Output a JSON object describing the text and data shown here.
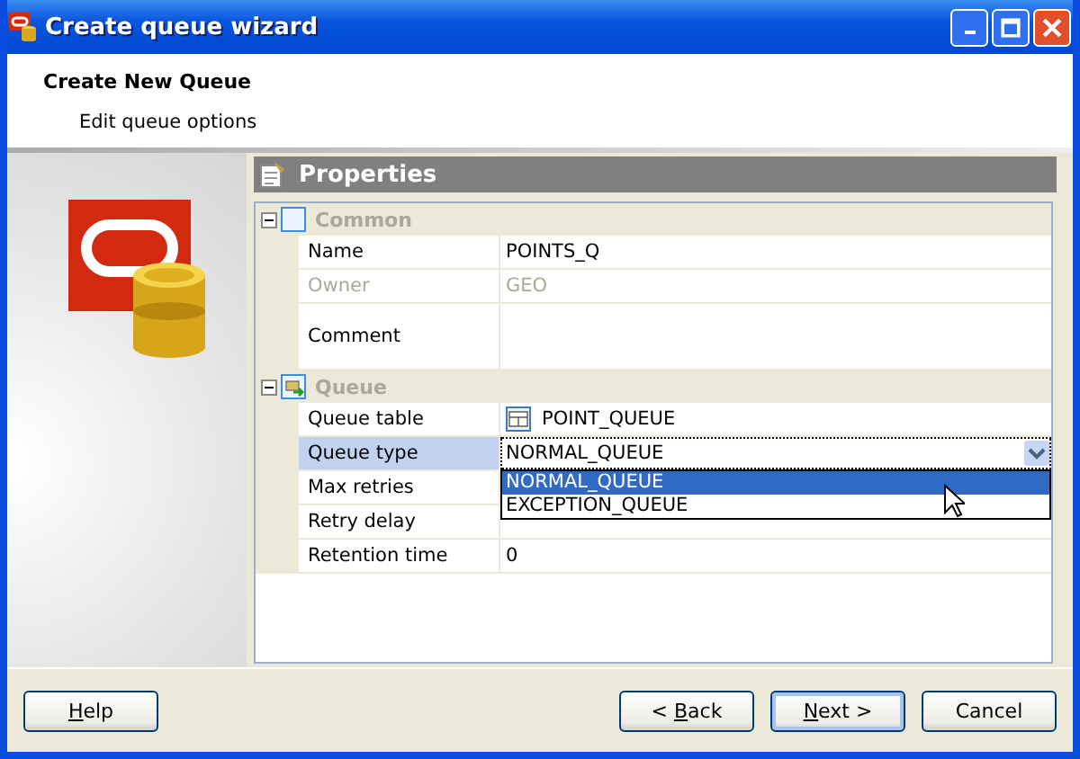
{
  "window": {
    "title": "Create queue wizard"
  },
  "header": {
    "title": "Create New Queue",
    "subtitle": "Edit queue options"
  },
  "properties": {
    "title": "Properties",
    "groups": [
      {
        "name": "Common",
        "expanded": true,
        "rows": [
          {
            "label": "Name",
            "value": "POINTS_Q",
            "kind": "text",
            "disabled": false,
            "selected": false
          },
          {
            "label": "Owner",
            "value": "GEO",
            "kind": "text",
            "disabled": true,
            "selected": false
          },
          {
            "label": "Comment",
            "kind": "memo",
            "disabled": false,
            "selected": false
          }
        ]
      },
      {
        "name": "Queue",
        "expanded": true,
        "rows": [
          {
            "label": "Queue table",
            "value": "POINT_QUEUE",
            "kind": "table-ref",
            "disabled": false,
            "selected": false
          },
          {
            "label": "Queue type",
            "value": "NORMAL_QUEUE",
            "kind": "dropdown",
            "disabled": false,
            "selected": true,
            "options": [
              {
                "label": "NORMAL_QUEUE",
                "selected": true
              },
              {
                "label": "EXCEPTION_QUEUE",
                "selected": false
              }
            ]
          },
          {
            "label": "Max retries",
            "kind": "text",
            "disabled": false,
            "selected": false
          },
          {
            "label": "Retry delay",
            "kind": "text",
            "disabled": false,
            "selected": false
          },
          {
            "label": "Retention time",
            "value": "0",
            "kind": "text",
            "disabled": false,
            "selected": false
          }
        ]
      }
    ]
  },
  "buttons": [
    {
      "access_key": "H",
      "after": "elp",
      "default": false
    },
    {
      "before": "< ",
      "access_key": "B",
      "after": "ack",
      "default": false
    },
    {
      "access_key": "N",
      "after": "ext >",
      "default": true
    },
    {
      "before": "Cancel",
      "default": false
    }
  ]
}
